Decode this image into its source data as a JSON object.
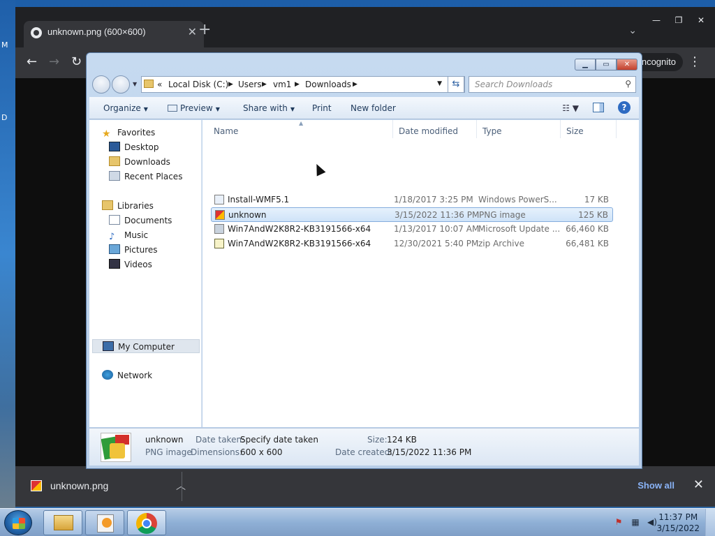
{
  "desktop": {
    "edge_letters": [
      "M",
      "D"
    ]
  },
  "chrome": {
    "tab_title": "unknown.png (600×600)",
    "incognito_label": "Incognito",
    "download": {
      "filename": "unknown.png",
      "show_all": "Show all"
    }
  },
  "explorer": {
    "address": [
      "«",
      "Local Disk (C:)",
      "Users",
      "vm1",
      "Downloads"
    ],
    "search_placeholder": "Search Downloads",
    "commands": {
      "organize": "Organize",
      "preview": "Preview",
      "share_with": "Share with",
      "print": "Print",
      "new_folder": "New folder"
    },
    "nav": {
      "favorites": "Favorites",
      "desktop": "Desktop",
      "downloads": "Downloads",
      "recent": "Recent Places",
      "libraries": "Libraries",
      "documents": "Documents",
      "music": "Music",
      "pictures": "Pictures",
      "videos": "Videos",
      "computer": "My Computer",
      "network": "Network"
    },
    "columns": {
      "name": "Name",
      "date": "Date modified",
      "type": "Type",
      "size": "Size"
    },
    "files": [
      {
        "name": "Install-WMF5.1",
        "date": "1/18/2017 3:25 PM",
        "type": "Windows PowerS...",
        "size": "17 KB"
      },
      {
        "name": "unknown",
        "date": "3/15/2022 11:36 PM",
        "type": "PNG image",
        "size": "125 KB"
      },
      {
        "name": "Win7AndW2K8R2-KB3191566-x64",
        "date": "1/13/2017 10:07 AM",
        "type": "Microsoft Update ...",
        "size": "66,460 KB"
      },
      {
        "name": "Win7AndW2K8R2-KB3191566-x64",
        "date": "12/30/2021 5:40 PM",
        "type": "zip Archive",
        "size": "66,481 KB"
      }
    ],
    "details": {
      "name": "unknown",
      "type": "PNG image",
      "date_taken_label": "Date taken:",
      "date_taken_value": "Specify date taken",
      "dimensions_label": "Dimensions:",
      "dimensions_value": "600 x 600",
      "size_label": "Size:",
      "size_value": "124 KB",
      "created_label": "Date created:",
      "created_value": "3/15/2022 11:36 PM"
    }
  },
  "taskbar": {
    "time": "11:37 PM",
    "date": "3/15/2022"
  }
}
